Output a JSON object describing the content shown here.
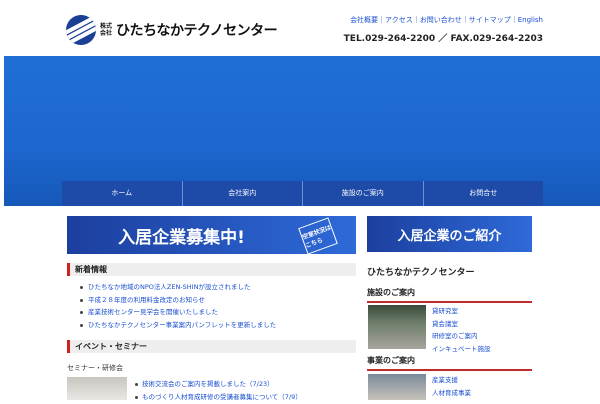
{
  "header": {
    "company_prefix": "株式会社",
    "company_name": "ひたちなかテクノセンター",
    "top_links": "会社概要｜アクセス｜お問い合わせ｜サイトマップ｜English",
    "contact": "TEL.029-264-2200 ／ FAX.029-264-2203"
  },
  "nav": {
    "items": [
      "ホーム",
      "会社案内",
      "施設のご案内",
      "お問合せ"
    ]
  },
  "banners": {
    "recruit": "入居企業募集中!",
    "recruit_stamp": "空室状況はこちら",
    "intro": "入居企業のご紹介"
  },
  "news": {
    "title": "新着情報",
    "items": [
      "ひたちなか地域のNPO法人ZEN-SHINが設立されました",
      "平成２８年度の利用料金改定のお知らせ",
      "産業技術センター見学会を開催いたしました",
      "ひたちなかテクノセンター事業案内パンフレットを更新しました"
    ]
  },
  "events": {
    "title": "イベント・セミナー",
    "sub_label": "セミナー・研修会",
    "items": [
      "技術交流会のご案内を掲載しました（7/23）",
      "ものづくり人材育成研修の受講者募集について（7/9）"
    ]
  },
  "sidebar": {
    "heading": "ひたちなかテクノセンター",
    "facility": {
      "title": "施設のご案内",
      "links": [
        "貸研究室",
        "貸会議室",
        "研修室のご案内",
        "インキュベート施設"
      ]
    },
    "business": {
      "title": "事業のご案内",
      "links": [
        "産業支援",
        "人材育成事業"
      ]
    }
  }
}
